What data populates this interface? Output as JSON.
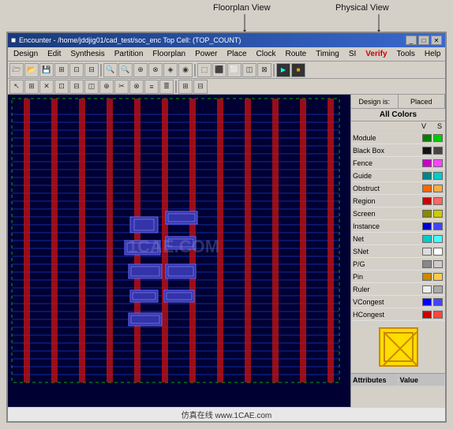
{
  "annotations": {
    "floorplan_label": "Floorplan View",
    "physical_label": "Physical View"
  },
  "window": {
    "title": "Encounter - /home/jddjig01/cad_test/soc_enc  Top Cell: (TOP_COUNT)",
    "title_icon": "■",
    "min_btn": "_",
    "max_btn": "□",
    "close_btn": "✕"
  },
  "menu": {
    "items": [
      "Design",
      "Edit",
      "Synthesis",
      "Partition",
      "Floorplan",
      "Power",
      "Place",
      "Clock",
      "Route",
      "Timing",
      "SI",
      "Verify",
      "Tools",
      "Help"
    ]
  },
  "toolbar": {
    "buttons": [
      "⬡",
      "⊞",
      "⧉",
      "⊡",
      "⊠",
      "◫",
      "⊟",
      "⊞",
      "|",
      "⊕",
      "⊗",
      "⊘",
      "⊙",
      "|",
      "◈",
      "◉",
      "◊",
      "◌",
      "|",
      "⬚",
      "⬛",
      "⬜",
      "⬝"
    ]
  },
  "right_panel": {
    "tabs": [
      "Design is:",
      "Placed"
    ],
    "title": "All Colors",
    "col_headers": [
      "V",
      "S"
    ],
    "rows": [
      {
        "label": "Module",
        "v_color": "#008000",
        "s_color": "#00cc00"
      },
      {
        "label": "Black Box",
        "v_color": "#000000",
        "s_color": "#444444"
      },
      {
        "label": "Fence",
        "v_color": "#cc00cc",
        "s_color": "#ff44ff"
      },
      {
        "label": "Guide",
        "v_color": "#008888",
        "s_color": "#00cccc"
      },
      {
        "label": "Obstruct",
        "v_color": "#ff8800",
        "s_color": "#ffaa44"
      },
      {
        "label": "Region",
        "v_color": "#880000",
        "s_color": "#cc4444"
      },
      {
        "label": "Screen",
        "v_color": "#888800",
        "s_color": "#cccc00"
      },
      {
        "label": "Instance",
        "v_color": "#0000cc",
        "s_color": "#4444ff"
      },
      {
        "label": "Net",
        "v_color": "#cc0000",
        "s_color": "#ff4444"
      },
      {
        "label": "SNet",
        "v_color": "#008800",
        "s_color": "#44cc44"
      },
      {
        "label": "P/G",
        "v_color": "#888888",
        "s_color": "#cccccc"
      },
      {
        "label": "Pin",
        "v_color": "#cc8800",
        "s_color": "#ffcc44"
      },
      {
        "label": "Ruler",
        "v_color": "#ffffff",
        "s_color": "#aaaaaa"
      },
      {
        "label": "VCongest",
        "v_color": "#0000ff",
        "s_color": "#4444ff"
      },
      {
        "label": "HCongest",
        "v_color": "#cc0044",
        "s_color": "#ff4488"
      }
    ],
    "preview_box": {
      "bg": "#ffdd00",
      "border": "#cc8800"
    },
    "attributes_header": "Attributes",
    "value_header": "Value"
  },
  "footer": {
    "text": "仿真在线  www.1CAE.com"
  },
  "watermark": "1CAE.COM"
}
